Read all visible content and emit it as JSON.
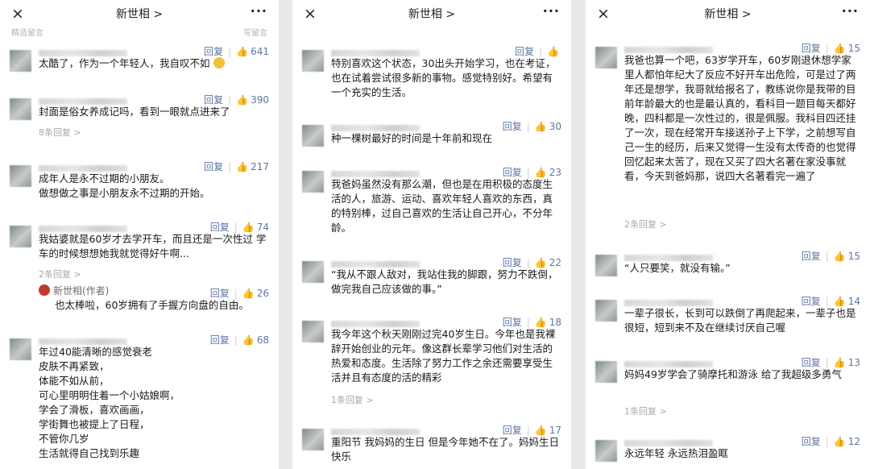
{
  "header": {
    "title": "新世相 >",
    "close_icon": "×",
    "more_icon": "···"
  },
  "faded_top": [
    "精选留言",
    "写留言"
  ],
  "panel1": [
    {
      "likes": "641",
      "reply_label": "回复",
      "text": "太酷了，作为一个年轻人，我自叹不如"
    },
    {
      "likes": "390",
      "reply_label": "回复",
      "text": "封面是俗女养成记吗，看到一眼就点进来了",
      "replies": "8条回复 >"
    },
    {
      "likes": "217",
      "reply_label": "回复",
      "text": "成年人是永不过期的小朋友。\n做想做之事是小朋友永不过期的开始。"
    },
    {
      "likes": "74",
      "reply_label": "回复",
      "text": "我姑婆就是60岁才去学开车，而且还是一次性过    学车的时候想想她我就觉得好牛啊...",
      "replies": "2条回复 >"
    },
    {
      "likes": "26",
      "reply_label": "回复",
      "author": "新世相(作者)",
      "text": "也太棒啦，60岁拥有了手握方向盘的自由。"
    },
    {
      "likes": "68",
      "reply_label": "回复",
      "text": "年过40能清晰的感觉衰老\n皮肤不再紧致，\n体能不如从前，\n可心里明明住着一个小姑娘啊，\n学会了滑板，喜欢画画，\n学街舞也被提上了日程，\n不管你几岁\n生活就得自己找到乐趣"
    }
  ],
  "panel2": [
    {
      "likes": "",
      "reply_label": "回复",
      "text": "特别喜欢这个状态，30出头开始学习，也在考证，也在试着尝试很多新的事物。感觉特别好。希望有一个充实的生活。"
    },
    {
      "likes": "30",
      "reply_label": "回复",
      "text": "种一棵树最好的时间是十年前和现在"
    },
    {
      "likes": "23",
      "reply_label": "回复",
      "text": "我爸妈虽然没有那么潮，但也是在用积极的态度生活的人，旅游、运动、喜欢年轻人喜欢的东西，真的特别棒，过自己喜欢的生活让自己开心，不分年龄。"
    },
    {
      "likes": "22",
      "reply_label": "回复",
      "text": "“我从不跟人敌对，我站住我的脚跟，努力不跌倒，做完我自己应该做的事。”"
    },
    {
      "likes": "18",
      "reply_label": "回复",
      "text": "我今年这个秋天刚刚过完40岁生日。今年也是我裸辞开始创业的元年。像这群长辈学习他们对生活的热爱和态度。生活除了努力工作之余还需要享受生活并且有态度的活的精彩",
      "replies": "1条回复 >"
    },
    {
      "likes": "17",
      "reply_label": "回复",
      "text": "重阳节 我妈妈的生日 但是今年她不在了。妈妈生日快乐"
    }
  ],
  "panel3": [
    {
      "likes": "15",
      "reply_label": "回复",
      "text": "我爸也算一个吧，63岁学开车，60岁刚退休想学家里人都怕年纪大了反应不好开车出危险，可是过了两年还是想学，我哥就给报名了，教练说你是我带的目前年龄最大的也是最认真的，看科目一题目每天都好晚，四科都是一次性过的，很是佩服。我科目四还挂了一次，现在经常开车接送孙子上下学，之前想写自己一生的经历，后来又觉得一生没有太传奇的也觉得回忆起来太苦了，现在又买了四大名著在家没事就看，今天到爸妈那，说四大名著看完一遍了",
      "replies": "2条回复 >"
    },
    {
      "likes": "15",
      "reply_label": "回复",
      "text": "“人只要笑，就没有输。”"
    },
    {
      "likes": "14",
      "reply_label": "回复",
      "text": "一辈子很长，长到可以跌倒了再爬起来，一辈子也是很短，短到来不及在继续讨厌自己喔"
    },
    {
      "likes": "13",
      "reply_label": "回复",
      "text": "妈妈49岁学会了骑摩托和游泳    给了我超级多勇气",
      "replies": "1条回复 >"
    },
    {
      "likes": "12",
      "reply_label": "回复",
      "text": "永远年轻 永远热泪盈眶"
    }
  ]
}
